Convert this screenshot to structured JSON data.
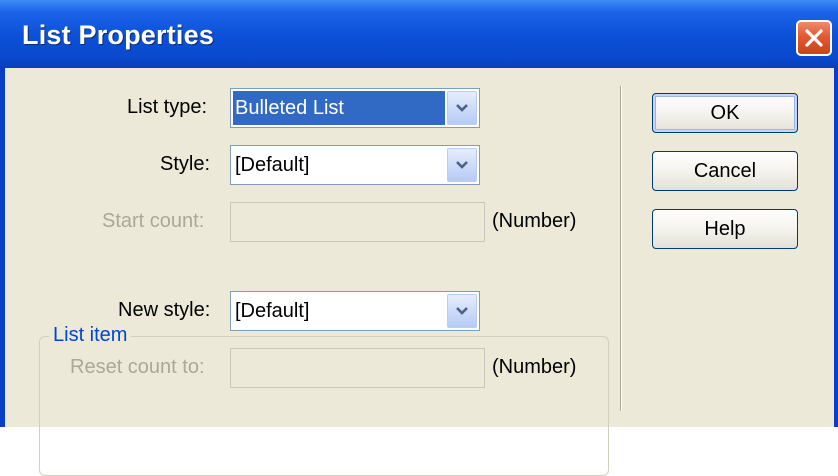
{
  "dialog": {
    "title": "List Properties",
    "close_icon": "close-icon"
  },
  "fields": {
    "list_type": {
      "label": "List type:",
      "value": "Bulleted List"
    },
    "style": {
      "label": "Style:",
      "value": "[Default]"
    },
    "start_count": {
      "label": "Start count:",
      "value": "",
      "unit": "(Number)",
      "enabled": false
    }
  },
  "list_item": {
    "group_label": "List item",
    "new_style": {
      "label": "New style:",
      "value": "[Default]"
    },
    "reset_count": {
      "label": "Reset count to:",
      "value": "",
      "unit": "(Number)",
      "enabled": false
    }
  },
  "buttons": {
    "ok": "OK",
    "cancel": "Cancel",
    "help": "Help"
  },
  "colors": {
    "titlebar": "#0a49cd",
    "dialog_bg": "#ece9d8",
    "selection": "#316ac5",
    "group_title": "#0046d5",
    "disabled_text": "#aca899",
    "close_button": "#e25a33"
  }
}
